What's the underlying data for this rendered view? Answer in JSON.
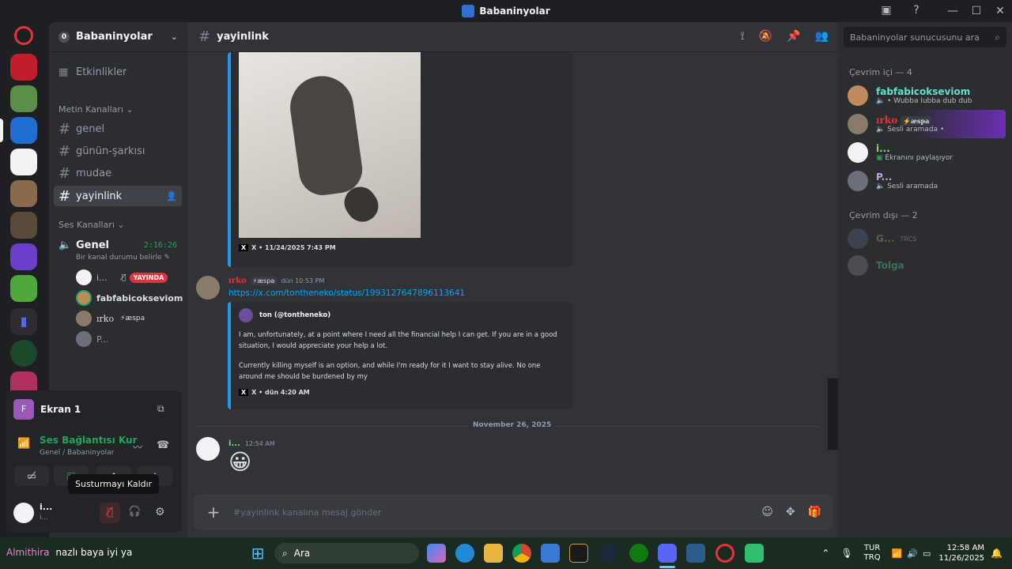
{
  "window": {
    "title": "Babaninyolar"
  },
  "server": {
    "name": "Babaninyolar",
    "badge": "0",
    "events": "Etkinlikler"
  },
  "channels": {
    "text_category": "Metin Kanalları",
    "text": [
      "genel",
      "günün-şarkısı",
      "mudae",
      "yayinlink"
    ],
    "voice_category": "Ses Kanalları",
    "voice_channel": "Genel",
    "voice_timer": "2:16:26",
    "status_hint": "Bir kanal durumu belirle",
    "voice_users": [
      {
        "name": "i...",
        "badge": "YAYINDA"
      },
      {
        "name": "fabfabicokseviom"
      },
      {
        "name": "ırko",
        "tag": "æspa"
      },
      {
        "name": "P..."
      }
    ]
  },
  "voice_panel": {
    "screen_label": "Ekran 1",
    "screen_initial": "F",
    "connection": "Ses Bağlantısı Kur",
    "connection_sub": "Genel / Babaninyolar",
    "tooltip": "Susturmayı Kaldır",
    "user_name": "i...",
    "user_sub": "i..."
  },
  "channel_header": {
    "name": "yayinlink"
  },
  "messages": {
    "embed1_footer": "X • 11/24/2025 7:43 PM",
    "msg2": {
      "author": "ırko",
      "tag": "æspa",
      "time": "dün 10:53 PM",
      "link": "https://x.com/tontheneko/status/1993127647896113641",
      "embed_author": "ton (@tontheneko)",
      "embed_p1": "I am, unfortunately, at a point where I need all the financial help I can get. If you are in a good situation, I would appreciate your help a lot.",
      "embed_p2": "Currently killing myself is an option, and while I'm ready for it I want to stay alive. No one around me should be burdened by my",
      "embed_footer": "X • dün 4:20 AM"
    },
    "date_divider": "November 26, 2025",
    "msg3": {
      "author": "i...",
      "time": "12:54 AM",
      "emoji": "😀"
    }
  },
  "composer": {
    "placeholder": "#yayinlink kanalına mesaj gönder"
  },
  "members": {
    "search_placeholder": "Babaninyolar sunucusunu ara",
    "online_header": "Çevrim içi — 4",
    "online": [
      {
        "name": "fabfabicokseviom",
        "status": "• Wubba lubba dub dub",
        "color": "#5ee6c4"
      },
      {
        "name": "ırko",
        "tag": "æspa",
        "status": "Sesli aramada •",
        "color": "#e6323a"
      },
      {
        "name": "i...",
        "status": "Ekranını paylaşıyor",
        "color": "#8fd96b"
      },
      {
        "name": "P...",
        "status": "Sesli aramada",
        "color": "#b9a7e6"
      }
    ],
    "offline_header": "Çevrim dışı — 2",
    "offline": [
      {
        "name": "G...",
        "tag": "TRCS"
      },
      {
        "name": "Tolga"
      }
    ]
  },
  "taskbar": {
    "notification_user": "Almithira",
    "notification_text": "nazlı baya iyi ya",
    "search": "Ara",
    "lang1": "TUR",
    "lang2": "TRQ",
    "time": "12:58 AM",
    "date": "11/26/2025"
  }
}
